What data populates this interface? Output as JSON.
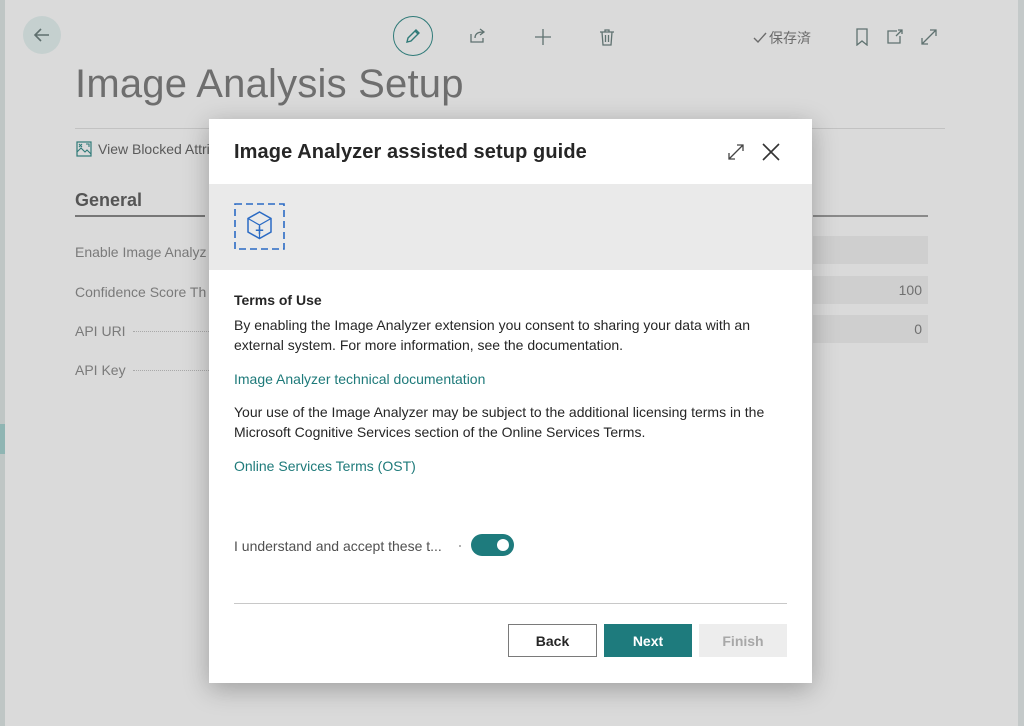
{
  "toolbar": {
    "saved_label": "保存済",
    "icons": [
      "back-arrow-icon",
      "pencil-icon",
      "share-icon",
      "plus-icon",
      "trash-icon",
      "check-icon",
      "bookmark-icon",
      "open-in-new-icon",
      "expand-icon"
    ]
  },
  "page": {
    "title": "Image Analysis Setup",
    "action_label": "View Blocked Attri",
    "section_title": "General",
    "fields": [
      {
        "label": "Enable Image Analyz",
        "value": ""
      },
      {
        "label": "Confidence Score Th",
        "value": "100"
      },
      {
        "label": "API URI",
        "value": "0"
      },
      {
        "label": "API Key",
        "value": ""
      }
    ]
  },
  "modal": {
    "title": "Image Analyzer assisted setup guide",
    "banner_icon": "cube-add-icon",
    "terms_heading": "Terms of Use",
    "paragraph1": "By enabling the Image Analyzer extension you consent to sharing your data with an external system. For more information, see the documentation.",
    "link1": "Image Analyzer technical documentation",
    "paragraph2": "Your use of the Image Analyzer may be subject to the additional licensing terms in the Microsoft Cognitive Services section of the Online Services Terms.",
    "link2": "Online Services Terms (OST)",
    "accept_label": "I understand and accept these t...",
    "accept_on": true,
    "buttons": {
      "back": "Back",
      "next": "Next",
      "finish": "Finish"
    }
  },
  "colors": {
    "accent": "#1e7b7d",
    "link": "#1e7a7a",
    "overlay_bg": "#d4d4d4"
  }
}
